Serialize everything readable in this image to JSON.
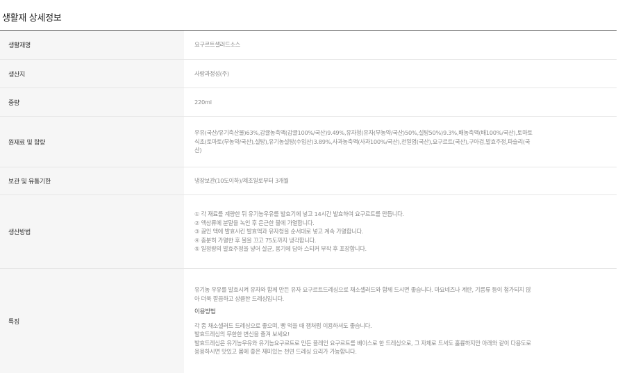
{
  "section_title": "생활재 상세정보",
  "rows": {
    "name": {
      "label": "생활재명",
      "value": "요구르트샐러드소스"
    },
    "origin": {
      "label": "생산지",
      "value": "사랑과정성(주)"
    },
    "weight": {
      "label": "중량",
      "value": "220ml"
    },
    "ingredients": {
      "label": "원재료 및 함량",
      "lines": [
        "우유(국산/유기축산물)63%,감귤농축액(감귤100%/국산)9.49%,유자청(유자(무농약/국산)50%,설탕50%)9.3%,배농축액(배100%/국산),토마토",
        "식초(토마토(무농약/국산),설탕),유기농설탕(수입산)3.89%,사과농축액(사과100%/국산),천일염(국산),요구르트(국산),구아검,발효주정,파슬리(국",
        "산)"
      ]
    },
    "storage": {
      "label": "보관 및 유통기한",
      "value": "냉장보관(10도이하)/제조일로부터 3개월"
    },
    "method": {
      "label": "생산방법",
      "steps": [
        "① 각 재료를 계량한 뒤 유기농우유를 발효기에 넣고 14시간 발효하여 요구르트를 만듭니다.",
        "② 액상류에 분말을 녹인 후 은근한 불에 가열합니다.",
        "③ 끓인 액에 발효시킨 발효액과 유자청을 순서대로 넣고 계속 가열합니다.",
        "④ 충분히 가열한 후 불을 끄고 75도까지 냉각합니다.",
        "⑤ 일정량의 발효주정을 넣어 살균, 용기에 담아 스티커 부착 후 포장합니다."
      ]
    },
    "features": {
      "label": "특징",
      "intro_lines": [
        "유기농 우유를 발효시켜 유자와 함께 만든 유자 요구르트드레싱으로 채소샐러드와 함께 드시면 좋습니다. 마요네즈나 계란, 기름류 등이 첨가되지 않",
        "아 더욱 깔끔하고 상큼한 드레싱입니다."
      ],
      "usage_title": "이용방법",
      "usage_lines": [
        "각 종 채소샐러드 드레싱으로 좋으며, 빵 먹을 때 잼처럼 이용하셔도 좋습니다.",
        "발효드레싱의 무한한 변신을 즐겨 보세요!",
        "발효드레싱은 유기농우유와 유기농요구르트로 만든 플레인 요구르트를 베이스로 한 드레싱으로, 그 자체로 드셔도 훌륭하지만 아래와 같이 다용도로",
        "응용하시면 맛있고 몸에 좋은 재미있는 천연 드레싱 요리가 가능합니다."
      ]
    }
  }
}
